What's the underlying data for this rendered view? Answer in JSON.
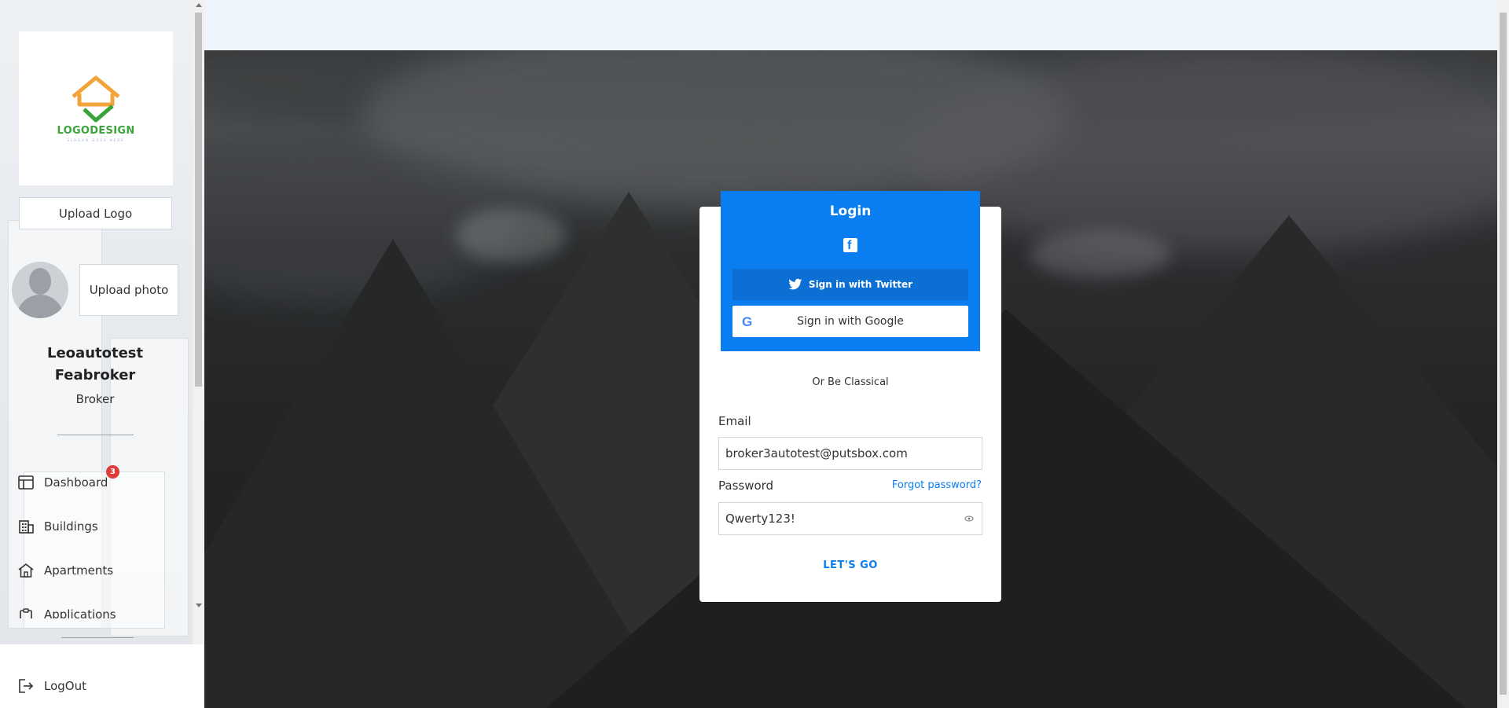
{
  "sidebar": {
    "logo": {
      "text": "LOGODESIGN",
      "slogan": "SLOGAN GOES HERE",
      "colors": {
        "roof": "#f2a33a",
        "check": "#3aa33a"
      }
    },
    "upload_logo_label": "Upload Logo",
    "upload_photo_label": "Upload photo",
    "user": {
      "name": "Leoautotest Feabroker",
      "role": "Broker"
    },
    "nav": [
      {
        "label": "Dashboard",
        "icon": "dashboard-icon",
        "badge": "3"
      },
      {
        "label": "Buildings",
        "icon": "buildings-icon"
      },
      {
        "label": "Apartments",
        "icon": "home-icon"
      },
      {
        "label": "Applications",
        "icon": "clipboard-icon"
      }
    ],
    "logout_label": "LogOut"
  },
  "login": {
    "title": "Login",
    "twitter_label": "Sign in with Twitter",
    "google_label": "Sign in with Google",
    "or_text": "Or Be Classical",
    "email_label": "Email",
    "email_value": "broker3autotest@putsbox.com",
    "password_label": "Password",
    "password_value": "Qwerty123!",
    "forgot_label": "Forgot password?",
    "submit_label": "LET'S GO",
    "colors": {
      "primary": "#0a7df0",
      "twitter_button": "#0b6fd3"
    }
  }
}
